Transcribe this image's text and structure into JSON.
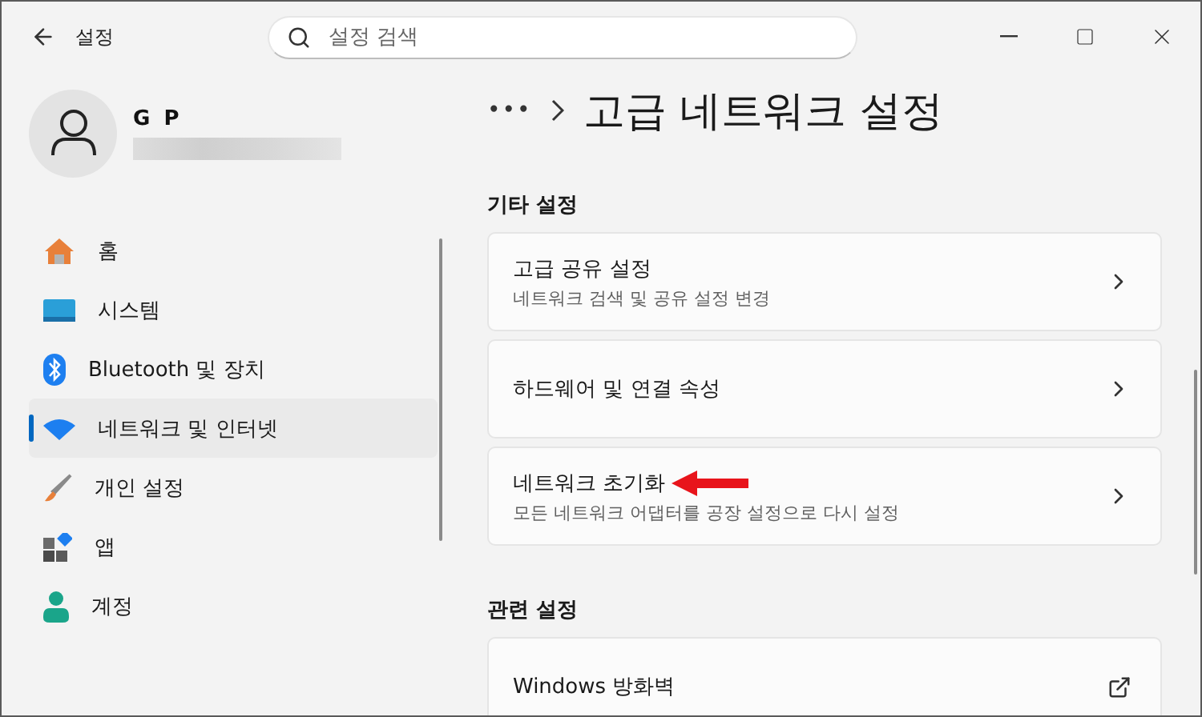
{
  "window": {
    "app_title": "설정"
  },
  "search": {
    "placeholder": "설정 검색"
  },
  "profile": {
    "name": "G P"
  },
  "sidebar": {
    "items": [
      {
        "label": "홈",
        "selected": false
      },
      {
        "label": "시스템",
        "selected": false
      },
      {
        "label": "Bluetooth 및 장치",
        "selected": false
      },
      {
        "label": "네트워크 및 인터넷",
        "selected": true
      },
      {
        "label": "개인 설정",
        "selected": false
      },
      {
        "label": "앱",
        "selected": false
      },
      {
        "label": "계정",
        "selected": false
      }
    ]
  },
  "breadcrumb": {
    "overflow": "•••",
    "title": "고급 네트워크 설정"
  },
  "sections": [
    {
      "title": "기타 설정",
      "cards": [
        {
          "title": "고급 공유 설정",
          "subtitle": "네트워크 검색 및 공유 설정 변경",
          "kind": "link",
          "annotated": false
        },
        {
          "title": "하드웨어 및 연결 속성",
          "kind": "link",
          "annotated": false
        },
        {
          "title": "네트워크 초기화",
          "subtitle": "모든 네트워크 어댑터를 공장 설정으로 다시 설정",
          "kind": "link",
          "annotated": true
        }
      ]
    },
    {
      "title": "관련 설정",
      "cards": [
        {
          "title": "Windows 방화벽",
          "kind": "external",
          "annotated": false
        }
      ]
    }
  ]
}
